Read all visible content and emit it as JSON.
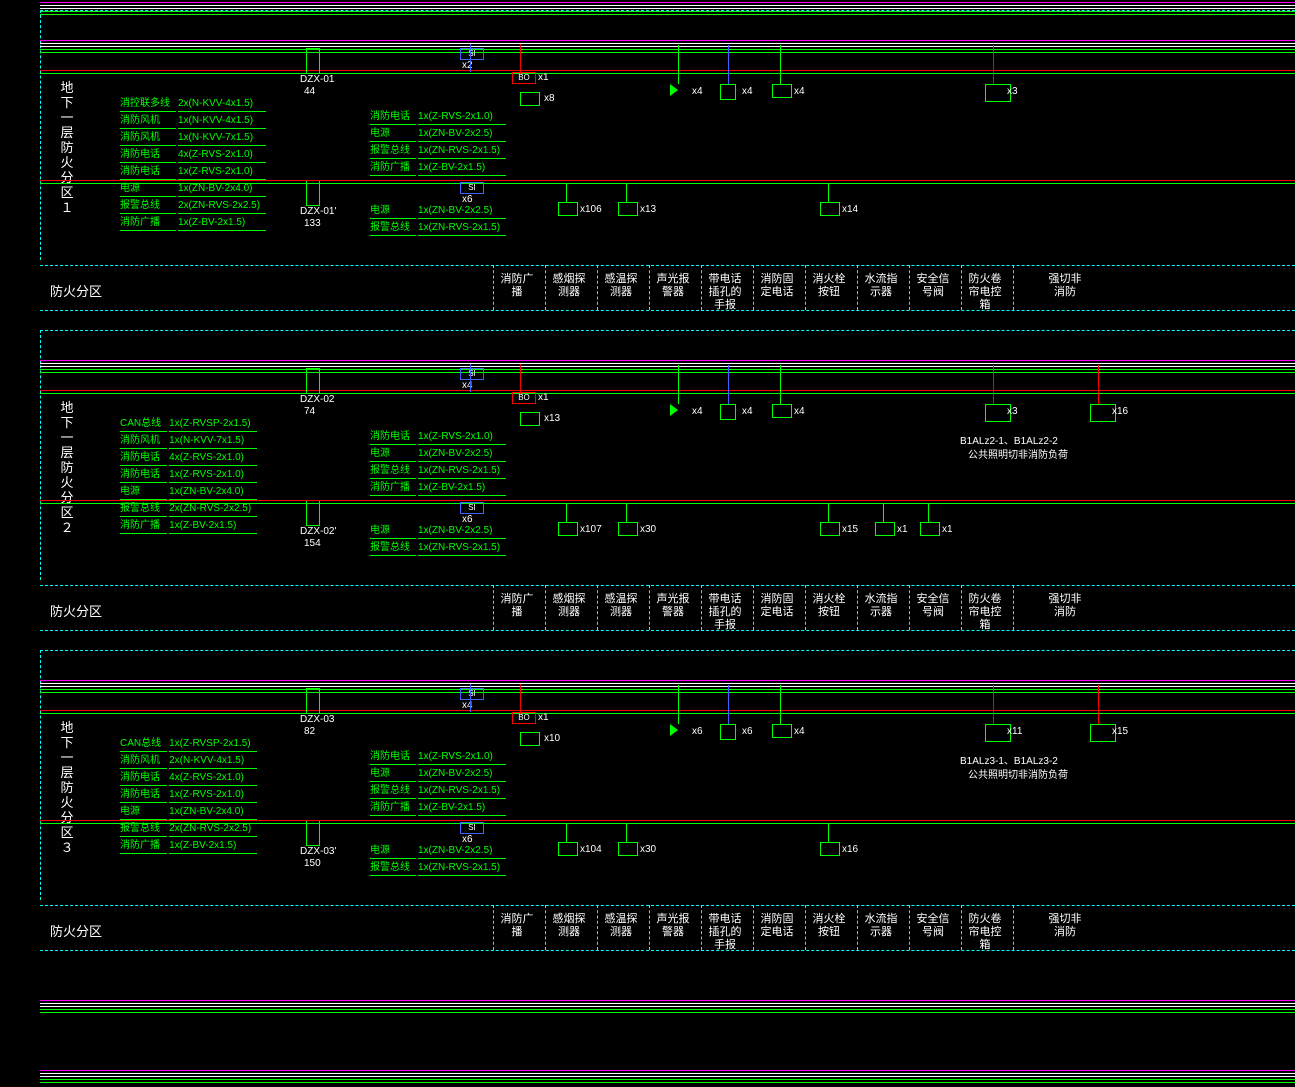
{
  "zones": [
    {
      "label": "地下一层防火分区１"
    },
    {
      "label": "地下一层防火分区２"
    },
    {
      "label": "地下一层防火分区３"
    }
  ],
  "legend_header": "防火分区",
  "legend_items": [
    "消防广播",
    "感烟探测器",
    "感温探测器",
    "声光报警器",
    "带电话插孔的手报",
    "消防固定电话",
    "消火栓按钮",
    "水流指示器",
    "安全信号阀",
    "防火卷帘电控箱",
    "强切非消防"
  ],
  "zone1": {
    "dzx_top": {
      "id": "DZX-01",
      "count": "44"
    },
    "dzx_bot": {
      "id": "DZX-01'",
      "count": "133"
    },
    "left_spec": [
      [
        "消控联多线",
        "2x(N-KVV-4x1.5)"
      ],
      [
        "消防风机",
        "1x(N-KVV-4x1.5)"
      ],
      [
        "消防风机",
        "1x(N-KVV-7x1.5)"
      ],
      [
        "消防电话",
        "4x(Z-RVS-2x1.0)"
      ],
      [
        "消防电话",
        "1x(Z-RVS-2x1.0)"
      ],
      [
        "电源",
        "1x(ZN-BV-2x4.0)"
      ],
      [
        "报警总线",
        "2x(ZN-RVS-2x2.5)"
      ],
      [
        "消防广播",
        "1x(Z-BV-2x1.5)"
      ]
    ],
    "mid_spec_top": [
      [
        "消防电话",
        "1x(Z-RVS-2x1.0)"
      ],
      [
        "电源",
        "1x(ZN-BV-2x2.5)"
      ],
      [
        "报警总线",
        "1x(ZN-RVS-2x1.5)"
      ],
      [
        "消防广播",
        "1x(Z-BV-2x1.5)"
      ]
    ],
    "mid_spec_bot": [
      [
        "电源",
        "1x(ZN-BV-2x2.5)"
      ],
      [
        "报警总线",
        "1x(ZN-RVS-2x1.5)"
      ]
    ],
    "si_top": "x2",
    "bo": "x1",
    "sp": "x8",
    "tri": "x4",
    "phone": "x4",
    "box": "x4",
    "io": "x3",
    "si_bot": "x6",
    "s1": "x106",
    "s2": "x13",
    "s3": "x14"
  },
  "zone2": {
    "dzx_top": {
      "id": "DZX-02",
      "count": "74"
    },
    "dzx_bot": {
      "id": "DZX-02'",
      "count": "154"
    },
    "left_spec": [
      [
        "CAN总线",
        "1x(Z-RVSP-2x1.5)"
      ],
      [
        "消防风机",
        "1x(N-KVV-7x1.5)"
      ],
      [
        "消防电话",
        "4x(Z-RVS-2x1.0)"
      ],
      [
        "消防电话",
        "1x(Z-RVS-2x1.0)"
      ],
      [
        "电源",
        "1x(ZN-BV-2x4.0)"
      ],
      [
        "报警总线",
        "2x(ZN-RVS-2x2.5)"
      ],
      [
        "消防广播",
        "1x(Z-BV-2x1.5)"
      ]
    ],
    "mid_spec_top": [
      [
        "消防电话",
        "1x(Z-RVS-2x1.0)"
      ],
      [
        "电源",
        "1x(ZN-BV-2x2.5)"
      ],
      [
        "报警总线",
        "1x(ZN-RVS-2x1.5)"
      ],
      [
        "消防广播",
        "1x(Z-BV-2x1.5)"
      ]
    ],
    "mid_spec_bot": [
      [
        "电源",
        "1x(ZN-BV-2x2.5)"
      ],
      [
        "报警总线",
        "1x(ZN-RVS-2x1.5)"
      ]
    ],
    "si_top": "x4",
    "bo": "x1",
    "sp": "x13",
    "tri": "x4",
    "phone": "x4",
    "box": "x4",
    "io": "x3",
    "io2": "x16",
    "ann1": "B1ALz2-1、B1ALz2-2",
    "ann2": "公共照明切非消防负荷",
    "si_bot": "x6",
    "s1": "x107",
    "s2": "x30",
    "s3": "x15",
    "s4": "x1",
    "s5": "x1"
  },
  "zone3": {
    "dzx_top": {
      "id": "DZX-03",
      "count": "82"
    },
    "dzx_bot": {
      "id": "DZX-03'",
      "count": "150"
    },
    "left_spec": [
      [
        "CAN总线",
        "1x(Z-RVSP-2x1.5)"
      ],
      [
        "消防风机",
        "2x(N-KVV-4x1.5)"
      ],
      [
        "消防电话",
        "4x(Z-RVS-2x1.0)"
      ],
      [
        "消防电话",
        "1x(Z-RVS-2x1.0)"
      ],
      [
        "电源",
        "1x(ZN-BV-2x4.0)"
      ],
      [
        "报警总线",
        "2x(ZN-RVS-2x2.5)"
      ],
      [
        "消防广播",
        "1x(Z-BV-2x1.5)"
      ]
    ],
    "mid_spec_top": [
      [
        "消防电话",
        "1x(Z-RVS-2x1.0)"
      ],
      [
        "电源",
        "1x(ZN-BV-2x2.5)"
      ],
      [
        "报警总线",
        "1x(ZN-RVS-2x1.5)"
      ],
      [
        "消防广播",
        "1x(Z-BV-2x1.5)"
      ]
    ],
    "mid_spec_bot": [
      [
        "电源",
        "1x(ZN-BV-2x2.5)"
      ],
      [
        "报警总线",
        "1x(ZN-RVS-2x1.5)"
      ]
    ],
    "si_top": "x4",
    "bo": "x1",
    "sp": "x10",
    "tri": "x6",
    "phone": "x6",
    "box": "x4",
    "io": "x11",
    "io2": "x15",
    "ann1": "B1ALz3-1、B1ALz3-2",
    "ann2": "公共照明切非消防负荷",
    "si_bot": "x6",
    "s1": "x104",
    "s2": "x30",
    "s3": "x16"
  }
}
